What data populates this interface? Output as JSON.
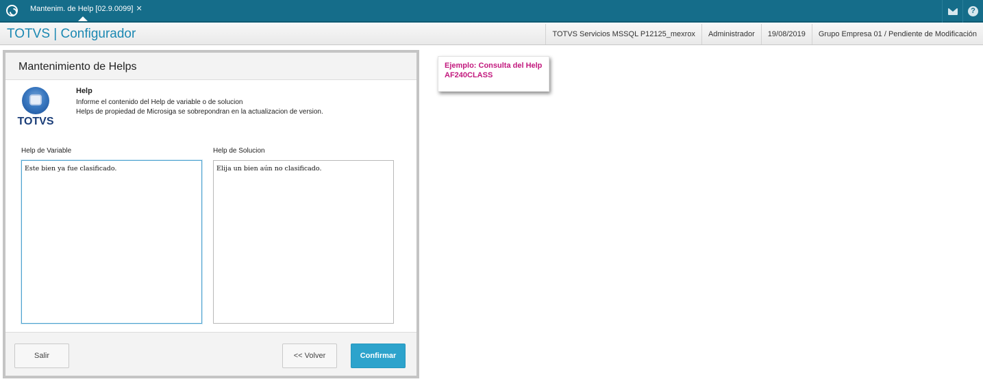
{
  "topbar": {
    "tab_label": "Mantenim. de Help [02.9.0099]",
    "tab_close": "✕",
    "help_glyph": "?"
  },
  "header": {
    "title": "TOTVS | Configurador",
    "environment": "TOTVS Servicios MSSQL P12125_mexrox",
    "user": "Administrador",
    "date": "19/08/2019",
    "company": "Grupo Empresa 01 / Pendiente de Modificación"
  },
  "dialog": {
    "title": "Mantenimiento de Helps",
    "logo_text": "TOTVS",
    "help_heading": "Help",
    "help_line1": "Informe el contenido del Help de variable o de solucion",
    "help_line2": "Helps de propiedad de Microsiga se sobrepondran en la actualizacion de version.",
    "variable_label": "Help de Variable",
    "variable_text": "Este bien ya fue clasificado.",
    "solution_label": "Help de Solucion",
    "solution_text": "Elija un bien aún no clasificado.",
    "buttons": {
      "exit": "Salir",
      "back": "<< Volver",
      "confirm": "Confirmar"
    }
  },
  "note": {
    "text": "Ejemplo: Consulta del Help AF240CLASS",
    "color": "#c2187d"
  },
  "colors": {
    "topbar": "#156d8a",
    "accent": "#1b88b2",
    "confirm_button": "#2da3cc"
  }
}
